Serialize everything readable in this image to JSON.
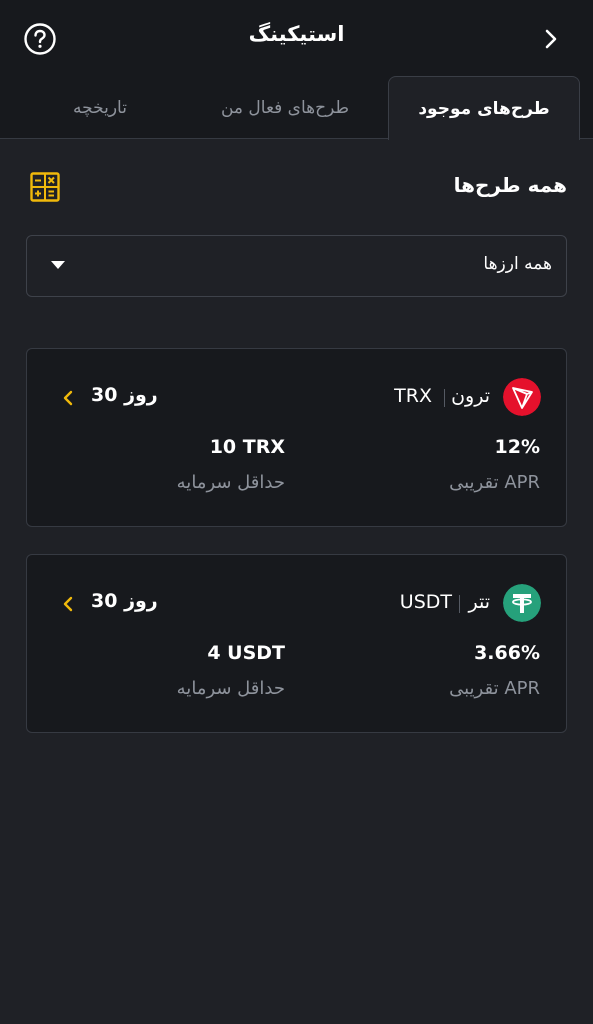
{
  "header": {
    "title": "استیکینگ",
    "help_icon": "question-circle-icon",
    "back_icon": "chevron-right-icon"
  },
  "tabs": [
    {
      "label": "طرح‌های موجود",
      "active": true
    },
    {
      "label": "طرح‌های فعال من",
      "active": false
    },
    {
      "label": "تاریخچه",
      "active": false
    }
  ],
  "section": {
    "title": "همه طرح‌ها",
    "calculator_icon": "calculator-icon"
  },
  "filter": {
    "selected": "همه ارزها"
  },
  "plans": [
    {
      "coin_name": "ترون",
      "symbol": "TRX",
      "duration": "30 روز",
      "apr": "12%",
      "apr_label": "APR تقریبی",
      "min_amount": "10 TRX",
      "min_label": "حداقل سرمایه",
      "logo_color": "#e5112c",
      "logo_icon": "tron-logo-icon"
    },
    {
      "coin_name": "تتر",
      "symbol": "USDT",
      "duration": "30 روز",
      "apr": "3.66%",
      "apr_label": "APR تقریبی",
      "min_amount": "4 USDT",
      "min_label": "حداقل سرمایه",
      "logo_color": "#26a17b",
      "logo_icon": "tether-logo-icon"
    }
  ],
  "colors": {
    "accent": "#f0b90b",
    "background": "#1f2126",
    "card": "#17191d",
    "muted_text": "#8e939c"
  }
}
